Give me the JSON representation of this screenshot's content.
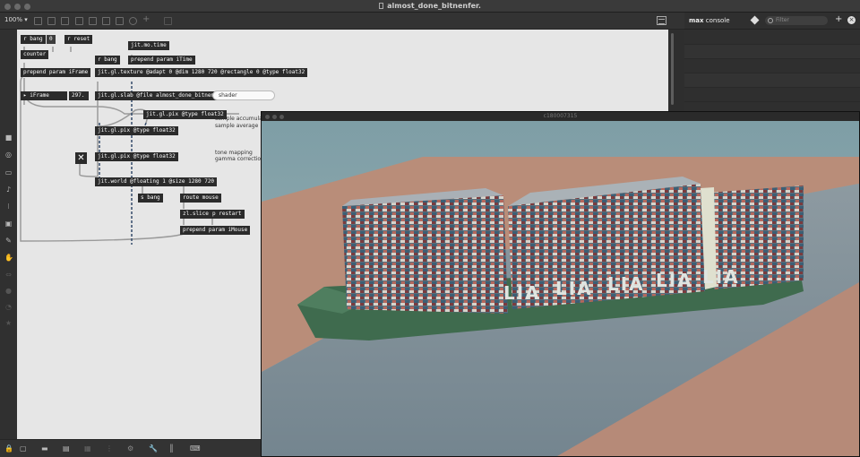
{
  "window": {
    "title": "almost_done_bitnenfer."
  },
  "toolbar": {
    "zoom": "100%"
  },
  "console": {
    "title_bold": "max",
    "title_rest": " console",
    "search_placeholder": "Filter",
    "add": "+",
    "close": "×"
  },
  "patcher": {
    "objects": {
      "r_bang": "r bang",
      "msg_zero": "0",
      "r_reset": "r reset",
      "counter": "counter",
      "prepend_iframe": "prepend param iFrame",
      "iframe_label": "iFrame",
      "iframe_value": "297.",
      "jit_mo_time": "jit.mo.time",
      "r_bang_2": "r bang",
      "prepend_itime": "prepend param iTime",
      "jit_gl_texture": "jit.gl.texture @adapt 0 @dim 1280 720 @rectangle 0 @type float32",
      "jit_gl_slab": "jit.gl.slab @file almost_done_bitnenfer.jxs",
      "jit_gl_pix_1": "jit.gl.pix @type float32",
      "jit_gl_pix_2": "jit.gl.pix @type float32",
      "jit_gl_pix_3": "jit.gl.pix @type float32",
      "jit_world": "jit.world @floating 1 @size 1280 720",
      "s_bang": "s bang",
      "route_mouse": "route mouse",
      "zl_slice": "zl.slice 3",
      "p_restart": "p restart",
      "prepend_imouse": "prepend param iMouse",
      "toggle_glyph": "✕"
    },
    "comments": {
      "shader": "shader",
      "sample_accum": "sample accumulati",
      "sample_avg": "sample average",
      "tone_mapping": "tone mapping",
      "gamma": "gamma correction"
    }
  },
  "render_window": {
    "title": "c180007315",
    "hull_text": "LIA"
  },
  "colors": {
    "patcher_bg": "#e6e6e6",
    "object_bg": "#2b2b2b",
    "hull_green": "#3f6b4e",
    "sand": "#b88b77",
    "water": "#8a9aa4"
  }
}
